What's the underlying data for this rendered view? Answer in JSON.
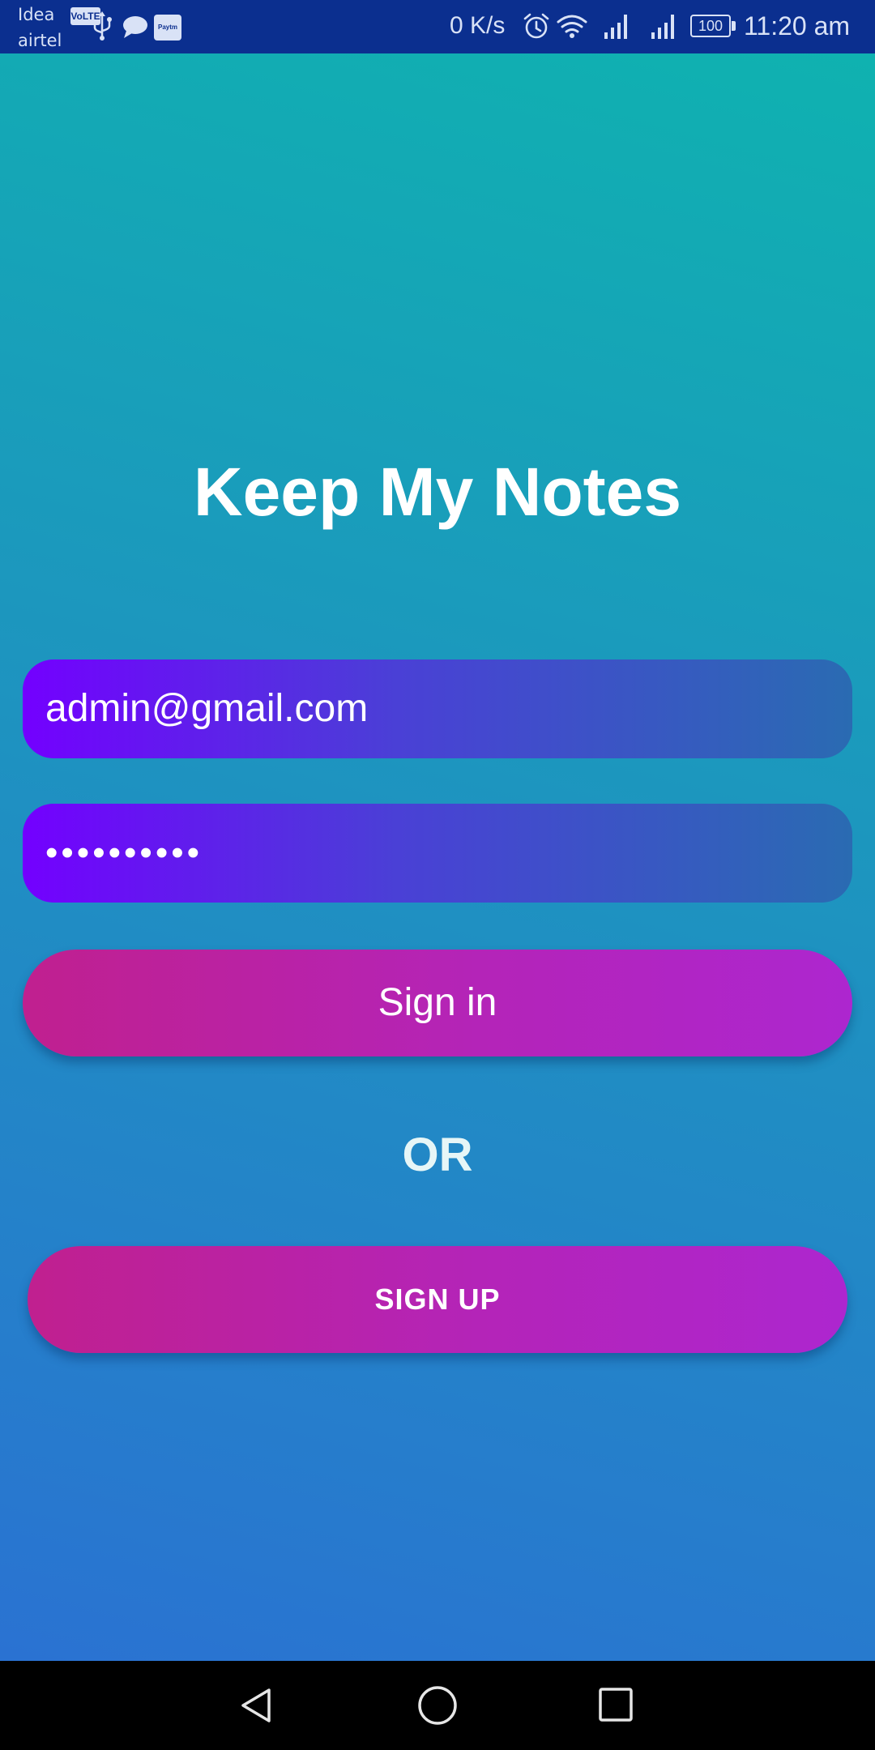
{
  "status_bar": {
    "carrier_1": "Idea",
    "volte_badge": "VoLTE",
    "carrier_2": "airtel",
    "paytm_label": "Paytm",
    "net_speed": "0 K/s",
    "battery": "100",
    "time": "11:20 am",
    "icons": [
      "usb-icon",
      "chat-icon",
      "paytm-icon",
      "alarm-icon",
      "wifi-icon",
      "signal-icon",
      "signal-icon",
      "battery-icon"
    ]
  },
  "app": {
    "title": "Keep My Notes",
    "email_value": "admin@gmail.com",
    "password_value": "••••••••••",
    "signin_label": "Sign in",
    "or_label": "OR",
    "signup_label": "SIGN UP"
  },
  "nav_bar": {
    "icons": [
      "back-icon",
      "home-icon",
      "recents-icon"
    ]
  },
  "colors": {
    "status_bar_bg": "#0b2f8f",
    "background_top": "#0fb2b0",
    "background_bottom": "#2a72d2",
    "field_start": "#7300ff",
    "field_end": "#2a6bb2",
    "button_start": "#c0208f",
    "button_end": "#ad26cf"
  }
}
